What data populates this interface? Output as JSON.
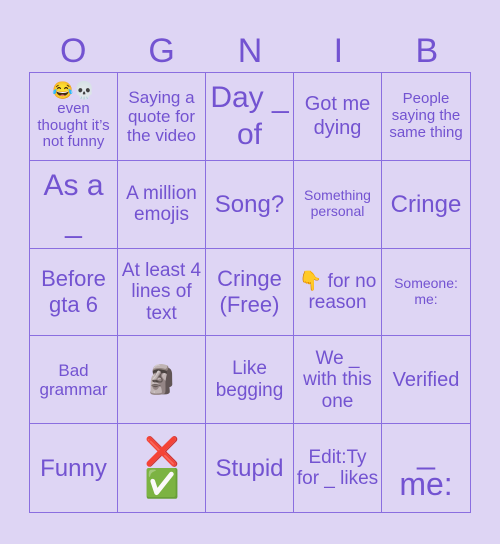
{
  "header": {
    "letters": [
      "O",
      "G",
      "N",
      "I",
      "B"
    ]
  },
  "colors": {
    "background": "#ded5f4",
    "text": "#7353d1",
    "grid": "#8a6ee0"
  },
  "cells": [
    {
      "icons": "😂💀",
      "text": "even thought it’s not funny"
    },
    {
      "text": "Saying a quote for the video"
    },
    {
      "text": "Day _ of"
    },
    {
      "text": "Got me dying"
    },
    {
      "text": "People saying the same thing"
    },
    {
      "text": "As a _"
    },
    {
      "text": "A million emojis"
    },
    {
      "text": "Song?"
    },
    {
      "text": "Something personal"
    },
    {
      "text": "Cringe"
    },
    {
      "text": "Before gta 6"
    },
    {
      "text": "At least 4 lines of text"
    },
    {
      "text": "Cringe (Free)"
    },
    {
      "icons": "👇",
      "text": "for no reason"
    },
    {
      "text": "Someone: me:"
    },
    {
      "text": "Bad grammar"
    },
    {
      "icons": "🗿",
      "text": ""
    },
    {
      "text": "Like begging"
    },
    {
      "text": "We _ with this one"
    },
    {
      "text": "Verified"
    },
    {
      "text": "Funny"
    },
    {
      "icons": "❌✅",
      "text": ""
    },
    {
      "text": "Stupid"
    },
    {
      "text": "Edit:Ty for _ likes"
    },
    {
      "text": "_ me:"
    }
  ]
}
